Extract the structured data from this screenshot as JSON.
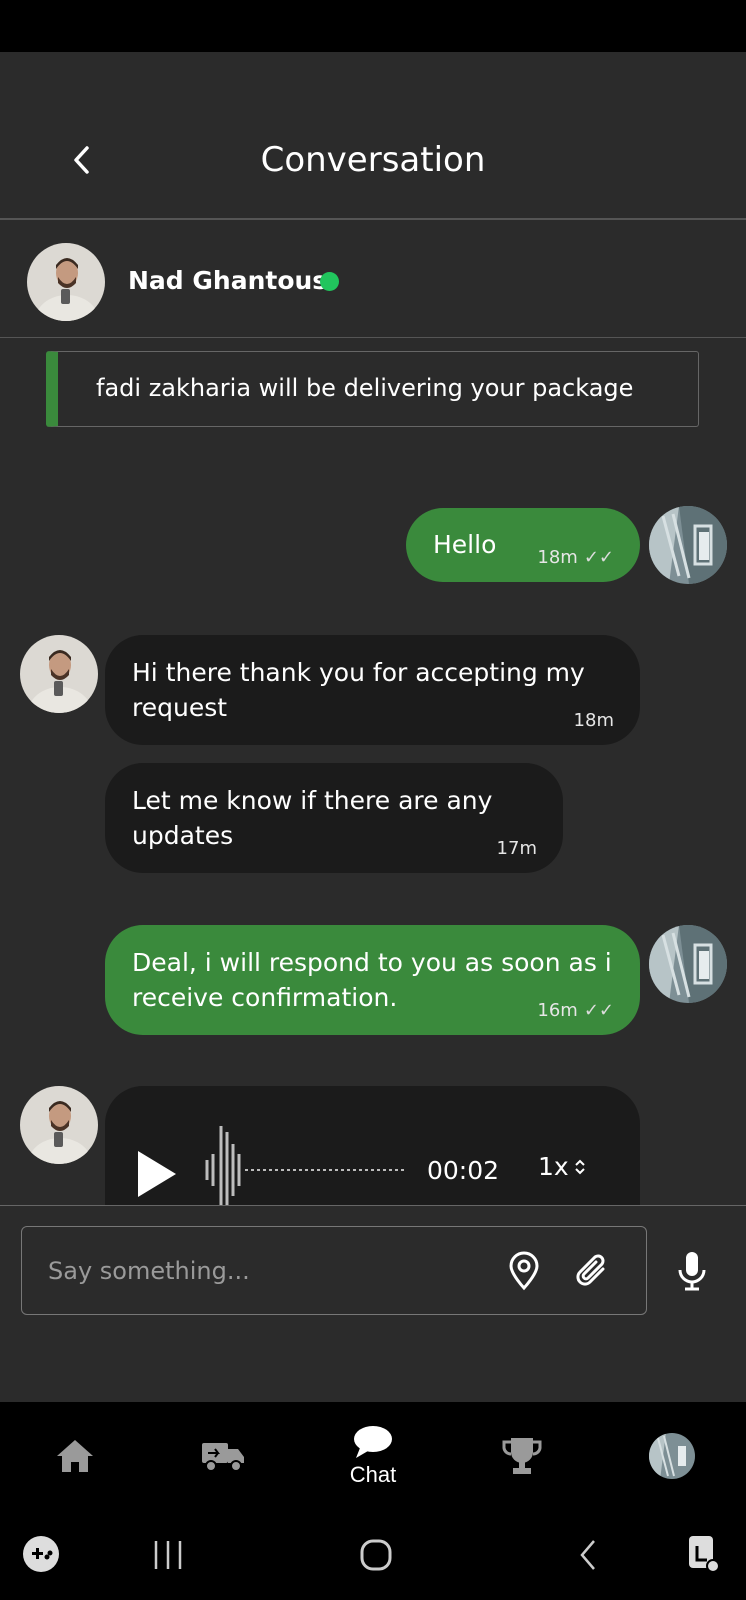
{
  "header": {
    "title": "Conversation",
    "back_icon": "chevron-left-icon"
  },
  "contact": {
    "name": "Nad Ghantous",
    "status": "online",
    "status_color": "#21c55d"
  },
  "notice": {
    "text": "fadi zakharia will be delivering your package",
    "accent_color": "#3a8a3c"
  },
  "messages": [
    {
      "direction": "out",
      "text": "Hello",
      "time": "18m",
      "ticks": "✓✓"
    },
    {
      "direction": "in",
      "text": "Hi there thank you for accepting my request",
      "time": "18m"
    },
    {
      "direction": "in",
      "text": "Let me know if there are any updates",
      "time": "17m"
    },
    {
      "direction": "out",
      "text": "Deal, i will respond to you as soon as i receive confirmation.",
      "time": "16m",
      "ticks": "✓✓"
    },
    {
      "direction": "in",
      "type": "audio",
      "duration": "00:02",
      "speed": "1x"
    }
  ],
  "composer": {
    "placeholder": "Say something...",
    "location_icon": "location-pin-icon",
    "attach_icon": "paperclip-icon",
    "mic_icon": "microphone-icon"
  },
  "nav": {
    "items": [
      {
        "icon": "home-icon",
        "label": ""
      },
      {
        "icon": "delivery-truck-icon",
        "label": ""
      },
      {
        "icon": "chat-bubble-icon",
        "label": "Chat"
      },
      {
        "icon": "trophy-icon",
        "label": ""
      },
      {
        "icon": "profile-avatar-icon",
        "label": ""
      }
    ]
  },
  "colors": {
    "background": "#2b2b2b",
    "outgoing_bubble": "#3a8a3c",
    "incoming_bubble": "#1b1b1b"
  }
}
